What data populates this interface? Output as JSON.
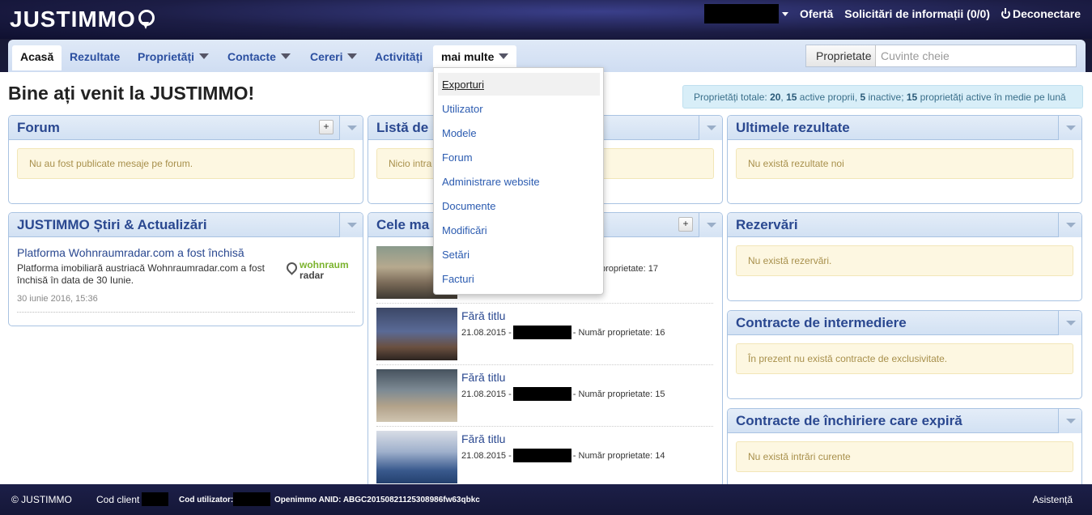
{
  "header": {
    "logo": "JUSTIMMO",
    "offer": "Ofertă",
    "requests": "Solicitări de informații (0/0)",
    "logout": "Deconectare"
  },
  "nav": {
    "items": [
      {
        "label": "Acasă"
      },
      {
        "label": "Rezultate"
      },
      {
        "label": "Proprietăți"
      },
      {
        "label": "Contacte"
      },
      {
        "label": "Cereri"
      },
      {
        "label": "Activități"
      },
      {
        "label": "mai multe"
      }
    ],
    "search_select": "Proprietate",
    "search_placeholder": "Cuvinte cheie"
  },
  "dropdown": {
    "items": [
      "Exporturi",
      "Utilizator",
      "Modele",
      "Forum",
      "Administrare website",
      "Documente",
      "Modificări",
      "Setări",
      "Facturi"
    ]
  },
  "page": {
    "title": "Bine ați venit la JUSTIMMO!",
    "stats_prefix": "Proprietăți totale: ",
    "stats_total": "20",
    "stats_sep1": ", ",
    "stats_active_own": "15",
    "stats_mid1": " active proprii, ",
    "stats_inactive": "5",
    "stats_mid2": " inactive; ",
    "stats_monthly": "15",
    "stats_suffix": " proprietăți active în medie pe lună"
  },
  "panels": {
    "forum": {
      "title": "Forum",
      "add": "+",
      "notice": "Nu au fost publicate mesaje pe forum."
    },
    "list": {
      "title": "Listă de",
      "notice": "Nicio intra"
    },
    "results": {
      "title": "Ultimele rezultate",
      "notice": "Nu există rezultate noi"
    },
    "news": {
      "title": "JUSTIMMO Știri & Actualizări",
      "headline": "Platforma Wohnraumradar.com a fost închisă",
      "text": "Platforma imobiliară austriacă Wohnraumradar.com a fost închisă în data de 30 Iunie.",
      "date": "30 iunie 2016, 15:36",
      "logo_top": "wohnraum",
      "logo_bottom": "radar"
    },
    "latest": {
      "title": "Cele ma",
      "add": "+",
      "items": [
        {
          "title": "",
          "date": "",
          "meta": "proprietate: 17"
        },
        {
          "title": "Fără titlu",
          "date": "21.08.2015 -",
          "meta": "- Număr proprietate: 16"
        },
        {
          "title": "Fără titlu",
          "date": "21.08.2015 -",
          "meta": "- Număr proprietate: 15"
        },
        {
          "title": "Fără titlu",
          "date": "21.08.2015 -",
          "meta": "- Număr proprietate: 14"
        }
      ]
    },
    "reservations": {
      "title": "Rezervări",
      "notice": "Nu există rezervări."
    },
    "brokerage": {
      "title": "Contracte de intermediere",
      "notice": "În prezent nu există contracte de exclusivitate."
    },
    "expiring": {
      "title": "Contracte de închiriere care expiră",
      "notice": "Nu există intrări curente"
    }
  },
  "footer": {
    "copyright": "© JUSTIMMO",
    "client_code": "Cod client",
    "user_code": "Cod utilizator:",
    "anid": "Openimmo ANID: ABGC20150821125308986fw63qbkc",
    "help": "Asistență"
  }
}
